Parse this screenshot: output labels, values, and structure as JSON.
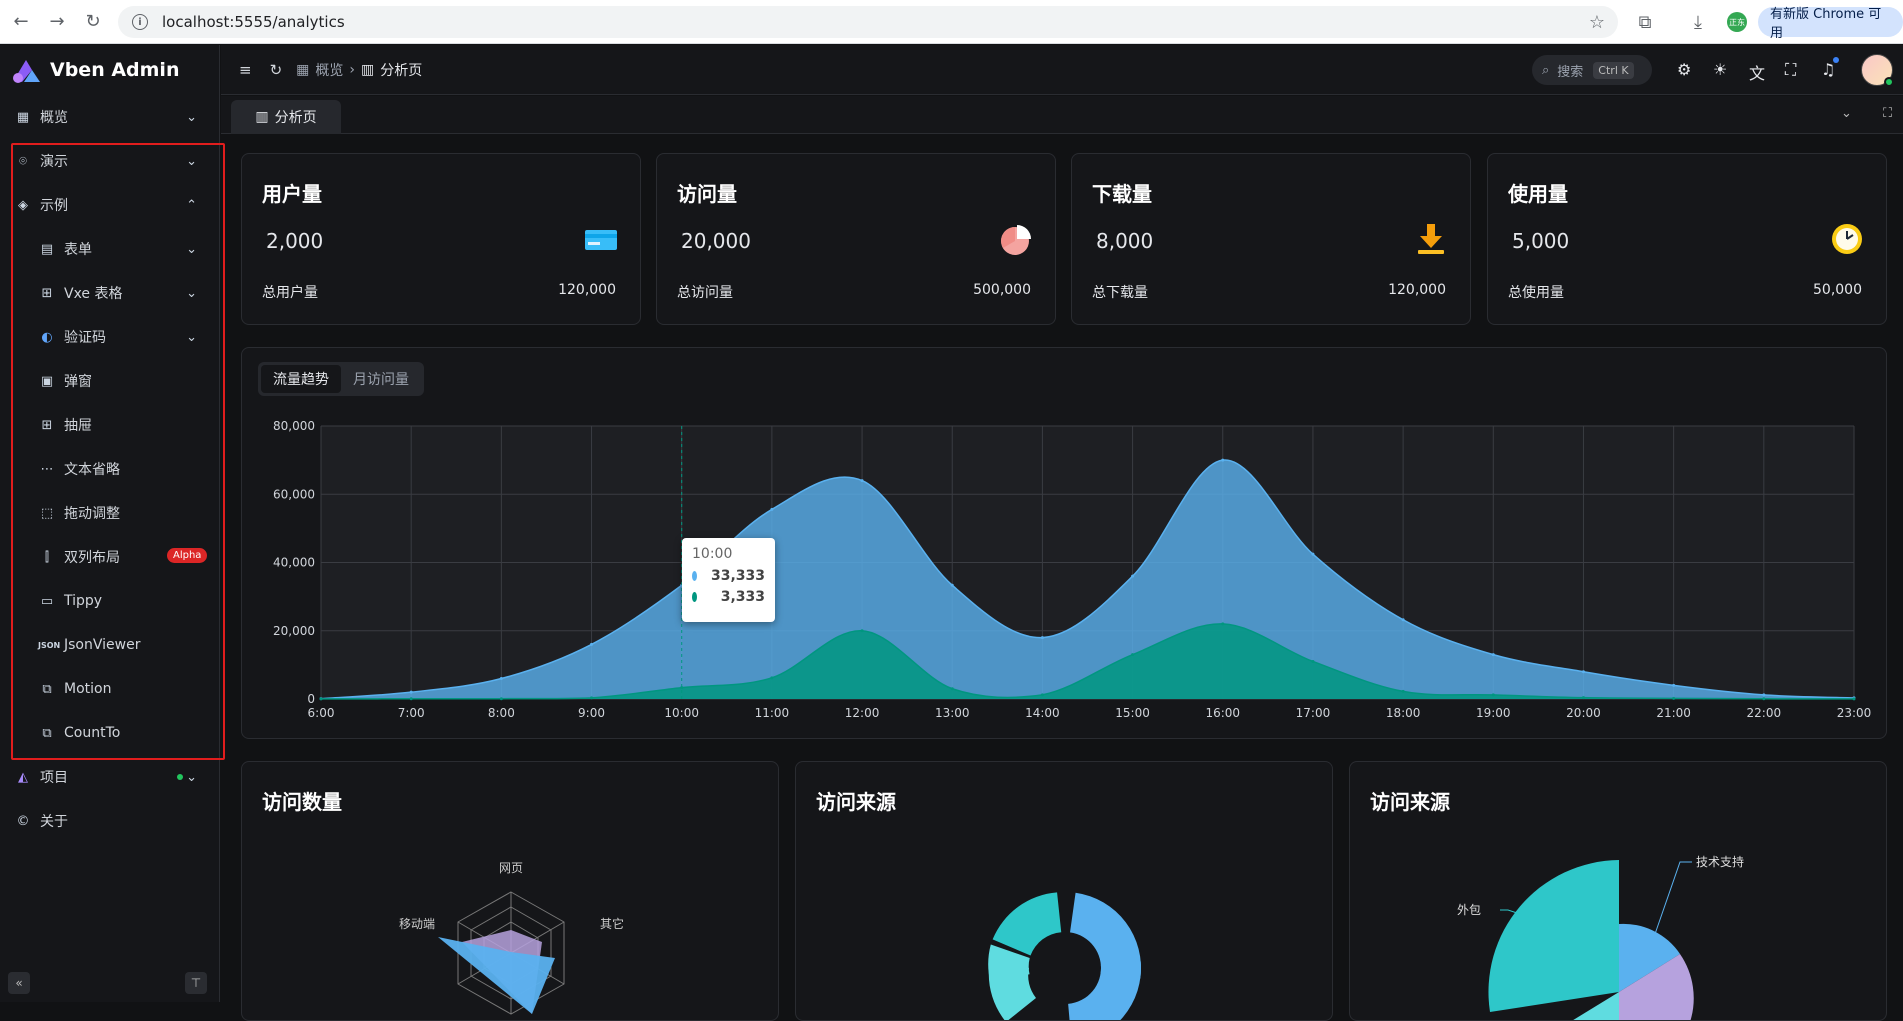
{
  "browser": {
    "url": "localhost:5555/analytics",
    "update_label": "有新版 Chrome 可用",
    "ext_label": "正东"
  },
  "app": {
    "title": "Vben Admin"
  },
  "sidebar": {
    "items": [
      {
        "label": "概览",
        "icon": "dashboard-icon"
      },
      {
        "label": "演示",
        "icon": "demo-icon"
      },
      {
        "label": "示例",
        "icon": "layers-icon"
      },
      {
        "label": "表单",
        "icon": "form-icon"
      },
      {
        "label": "Vxe 表格",
        "icon": "table-icon"
      },
      {
        "label": "验证码",
        "icon": "captcha-icon"
      },
      {
        "label": "弹窗",
        "icon": "modal-icon"
      },
      {
        "label": "抽屉",
        "icon": "drawer-icon"
      },
      {
        "label": "文本省略",
        "icon": "ellipsis-icon"
      },
      {
        "label": "拖动调整",
        "icon": "resize-icon"
      },
      {
        "label": "双列布局",
        "icon": "columns-icon"
      },
      {
        "label": "Tippy",
        "icon": "tooltip-icon"
      },
      {
        "label": "JsonViewer",
        "icon": "json-icon"
      },
      {
        "label": "Motion",
        "icon": "motion-icon"
      },
      {
        "label": "CountTo",
        "icon": "count-icon"
      },
      {
        "label": "项目",
        "icon": "project-icon"
      },
      {
        "label": "关于",
        "icon": "copyright-icon"
      }
    ],
    "alpha_badge": "Alpha"
  },
  "header": {
    "breadcrumb_root": "概览",
    "breadcrumb_current": "分析页",
    "search_placeholder": "搜索",
    "search_shortcut": "Ctrl K"
  },
  "tabs": [
    {
      "label": "分析页"
    }
  ],
  "stats": [
    {
      "title": "用户量",
      "value": "2,000",
      "sub": "总用户量",
      "total": "120,000",
      "icon": "credit-card-icon"
    },
    {
      "title": "访问量",
      "value": "20,000",
      "sub": "总访问量",
      "total": "500,000",
      "icon": "pie-icon"
    },
    {
      "title": "下载量",
      "value": "8,000",
      "sub": "总下载量",
      "total": "120,000",
      "icon": "download-icon"
    },
    {
      "title": "使用量",
      "value": "5,000",
      "sub": "总使用量",
      "total": "50,000",
      "icon": "clock-icon"
    }
  ],
  "trend": {
    "tabs": [
      "流量趋势",
      "月访问量"
    ],
    "tooltip": {
      "label": "10:00",
      "v1": "33,333",
      "v2": "3,333"
    }
  },
  "bottom_cards": [
    {
      "title": "访问数量"
    },
    {
      "title": "访问来源"
    },
    {
      "title": "访问来源"
    }
  ],
  "radar_labels": {
    "top": "网页",
    "left": "移动端",
    "right": "其它"
  },
  "pie_labels": {
    "a": "技术支持",
    "b": "外包"
  },
  "colors": {
    "series1": "#5ab1ef",
    "series2": "#019680",
    "teal": "#2ec7c9",
    "purple": "#b6a2de"
  },
  "chart_data": {
    "type": "area",
    "x": [
      "6:00",
      "7:00",
      "8:00",
      "9:00",
      "10:00",
      "11:00",
      "12:00",
      "13:00",
      "14:00",
      "15:00",
      "16:00",
      "17:00",
      "18:00",
      "19:00",
      "20:00",
      "21:00",
      "22:00",
      "23:00"
    ],
    "series": [
      {
        "values": [
          111,
          2000,
          6000,
          16000,
          33333,
          55555,
          64000,
          33333,
          18000,
          36000,
          70000,
          42444,
          23222,
          13000,
          8000,
          4000,
          1200,
          333
        ]
      },
      {
        "values": [
          33,
          66,
          88,
          333,
          3333,
          6200,
          20000,
          3000,
          1200,
          13000,
          22000,
          11000,
          2221,
          1201,
          390,
          198,
          60,
          30
        ]
      }
    ],
    "ylim": [
      0,
      80000
    ],
    "yticks": [
      "0",
      "20,000",
      "40,000",
      "60,000",
      "80,000"
    ],
    "grid": true
  }
}
